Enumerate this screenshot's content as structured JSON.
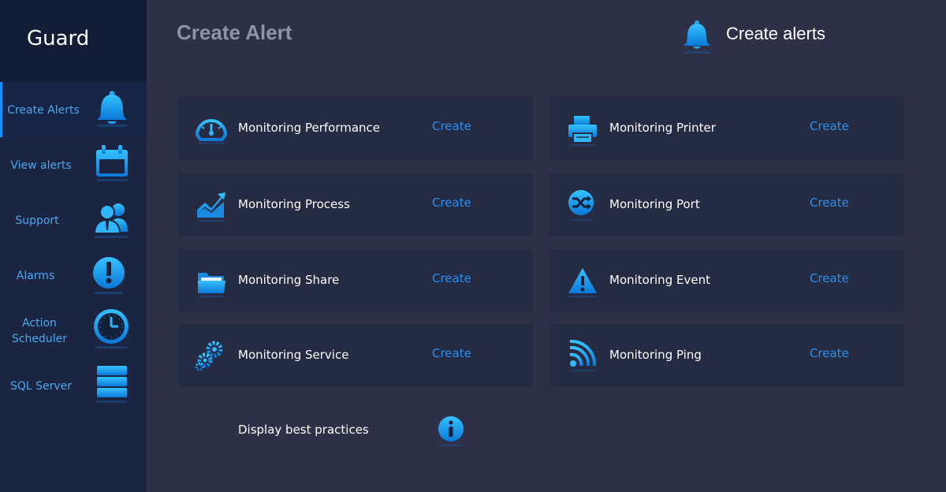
{
  "app": {
    "brand": "Guard"
  },
  "sidebar": {
    "items": [
      {
        "label": "Create Alerts",
        "icon": "bell-icon",
        "active": true
      },
      {
        "label": "View alerts",
        "icon": "calendar-icon"
      },
      {
        "label": "Support",
        "icon": "users-icon"
      },
      {
        "label": "Alarms",
        "icon": "exclamation-icon"
      },
      {
        "label": "Action Scheduler",
        "icon": "clock-icon"
      },
      {
        "label": "SQL Server",
        "icon": "database-icon"
      }
    ]
  },
  "header": {
    "title": "Create Alert",
    "right_title": "Create alerts",
    "right_icon": "bell-icon"
  },
  "cards": [
    {
      "label": "Monitoring Performance",
      "action": "Create",
      "icon": "gauge-icon"
    },
    {
      "label": "Monitoring Printer",
      "action": "Create",
      "icon": "printer-icon"
    },
    {
      "label": "Monitoring Process",
      "action": "Create",
      "icon": "trend-chart-icon"
    },
    {
      "label": "Monitoring Port",
      "action": "Create",
      "icon": "shuffle-icon"
    },
    {
      "label": "Monitoring Share",
      "action": "Create",
      "icon": "folder-icon"
    },
    {
      "label": "Monitoring Event",
      "action": "Create",
      "icon": "warning-icon"
    },
    {
      "label": "Monitoring Service",
      "action": "Create",
      "icon": "gears-icon"
    },
    {
      "label": "Monitoring Ping",
      "action": "Create",
      "icon": "rss-icon"
    }
  ],
  "footer": {
    "best_practices": "Display best practices",
    "icon": "info-icon"
  },
  "colors": {
    "accent": "#2a8ff2",
    "sidebar_bg": "#1b2440",
    "main_bg": "#2d3047",
    "card_bg": "#252b42",
    "icon": "#1aa3ec"
  }
}
